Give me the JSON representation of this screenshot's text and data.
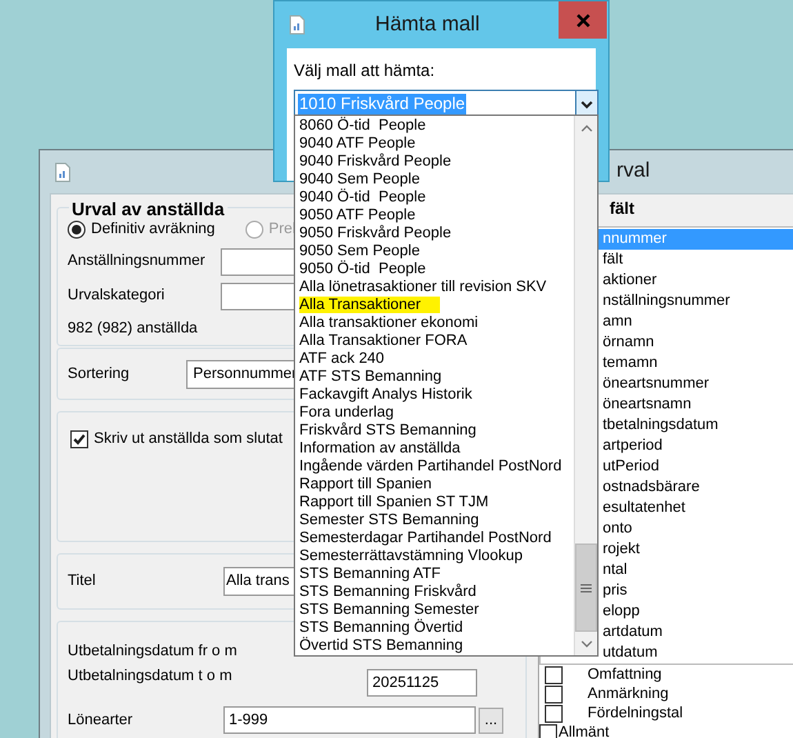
{
  "back_window": {
    "title": "rval",
    "selection_group": {
      "legend": "Urval av anställda",
      "radios": [
        {
          "label": "Definitiv avräkning",
          "selected": true
        },
        {
          "label": "Prel",
          "selected": false
        }
      ],
      "fields": [
        {
          "label": "Anställningsnummer"
        },
        {
          "label": "Urvalskategori"
        }
      ],
      "count": "982 (982) anställda"
    },
    "sort": {
      "label": "Sortering",
      "value": "Personnummer"
    },
    "options": [
      {
        "label": "Skriv ut anställda som slutat",
        "checked": true
      }
    ],
    "title_field": {
      "label": "Titel",
      "value": "Alla trans"
    },
    "payment_dates": [
      {
        "label": "Utbetalningsdatum fr o m"
      },
      {
        "label": "Utbetalningsdatum t o m",
        "value": "20251125"
      }
    ],
    "ranges": [
      {
        "label": "Lönearter",
        "value": "1-999",
        "button": "..."
      }
    ],
    "fields_header": "fält",
    "field_list": [
      {
        "label": "nnummer",
        "selected": true
      },
      {
        "label": "fält",
        "selected": false
      },
      {
        "label": "aktioner",
        "selected": false
      },
      {
        "label": "nställningsnummer",
        "selected": false
      },
      {
        "label": "amn",
        "selected": false
      },
      {
        "label": "örnamn",
        "selected": false
      },
      {
        "label": "temamn",
        "selected": false
      },
      {
        "label": "öneartsnummer",
        "selected": false
      },
      {
        "label": "öneartsnamn",
        "selected": false
      },
      {
        "label": "tbetalningsdatum",
        "selected": false
      },
      {
        "label": "artperiod",
        "selected": false
      },
      {
        "label": "utPeriod",
        "selected": false
      },
      {
        "label": "ostnadsbärare",
        "selected": false
      },
      {
        "label": "esultatenhet",
        "selected": false
      },
      {
        "label": "onto",
        "selected": false
      },
      {
        "label": "rojekt",
        "selected": false
      },
      {
        "label": "ntal",
        "selected": false
      },
      {
        "label": "pris",
        "selected": false
      },
      {
        "label": "elopp",
        "selected": false
      },
      {
        "label": "artdatum",
        "selected": false
      },
      {
        "label": "utdatum",
        "selected": false
      }
    ],
    "field_tree": [
      {
        "children": [
          {
            "label": "Omfattning",
            "checked": false
          },
          {
            "label": "Anmärkning",
            "checked": false
          },
          {
            "label": "Fördelningstal",
            "checked": false
          }
        ]
      },
      {
        "label": "Allmänt",
        "checked": false
      }
    ]
  },
  "dialog": {
    "title": "Hämta mall",
    "prompt": "Välj mall att hämta:",
    "value": "1010 Friskvård People",
    "options": [
      {
        "label": "8060 Ö-tid  People",
        "highlighted": false
      },
      {
        "label": "9040 ATF People",
        "highlighted": false
      },
      {
        "label": "9040 Friskvård People",
        "highlighted": false
      },
      {
        "label": "9040 Sem People",
        "highlighted": false
      },
      {
        "label": "9040 Ö-tid  People",
        "highlighted": false
      },
      {
        "label": "9050 ATF People",
        "highlighted": false
      },
      {
        "label": "9050 Friskvård People",
        "highlighted": false
      },
      {
        "label": "9050 Sem People",
        "highlighted": false
      },
      {
        "label": "9050 Ö-tid  People",
        "highlighted": false
      },
      {
        "label": "Alla lönetrasaktioner till revision SKV",
        "highlighted": false
      },
      {
        "label": "Alla Transaktioner",
        "highlighted": true
      },
      {
        "label": "Alla transaktioner ekonomi",
        "highlighted": false
      },
      {
        "label": "Alla Transaktioner FORA",
        "highlighted": false
      },
      {
        "label": "ATF ack 240",
        "highlighted": false
      },
      {
        "label": "ATF STS Bemanning",
        "highlighted": false
      },
      {
        "label": "Fackavgift Analys Historik",
        "highlighted": false
      },
      {
        "label": "Fora underlag",
        "highlighted": false
      },
      {
        "label": "Friskvård STS Bemanning",
        "highlighted": false
      },
      {
        "label": "Information av anställda",
        "highlighted": false
      },
      {
        "label": "Ingående värden Partihandel PostNord",
        "highlighted": false
      },
      {
        "label": "Rapport till Spanien",
        "highlighted": false
      },
      {
        "label": "Rapport till Spanien ST TJM",
        "highlighted": false
      },
      {
        "label": "Semester STS Bemanning",
        "highlighted": false
      },
      {
        "label": "Semesterdagar Partihandel PostNord",
        "highlighted": false
      },
      {
        "label": "Semesterrättavstämning Vlookup",
        "highlighted": false
      },
      {
        "label": "STS Bemanning ATF",
        "highlighted": false
      },
      {
        "label": "STS Bemanning Friskvård",
        "highlighted": false
      },
      {
        "label": "STS Bemanning Semester",
        "highlighted": false
      },
      {
        "label": "STS Bemanning Övertid",
        "highlighted": false
      },
      {
        "label": "Övertid STS Bemanning",
        "highlighted": false
      }
    ]
  }
}
